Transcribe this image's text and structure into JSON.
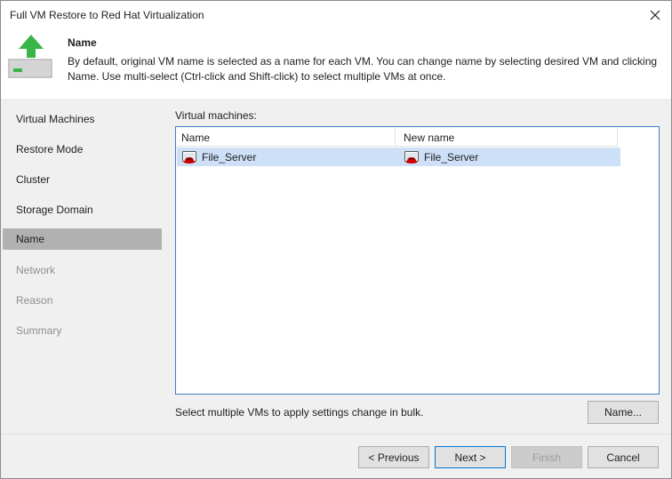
{
  "window": {
    "title": "Full VM Restore to Red Hat Virtualization",
    "close_icon": "close-icon"
  },
  "header": {
    "icon": "restore-upload-icon",
    "title": "Name",
    "description": "By default, original VM name is selected as a name for each VM. You can change name by selecting desired VM and clicking Name. Use multi-select (Ctrl-click and Shift-click) to select multiple VMs at once."
  },
  "sidebar": {
    "steps": [
      {
        "label": "Virtual Machines",
        "state": "normal"
      },
      {
        "label": "Restore Mode",
        "state": "normal"
      },
      {
        "label": "Cluster",
        "state": "normal"
      },
      {
        "label": "Storage Domain",
        "state": "normal"
      },
      {
        "label": "Name",
        "state": "active"
      },
      {
        "label": "Network",
        "state": "disabled"
      },
      {
        "label": "Reason",
        "state": "disabled"
      },
      {
        "label": "Summary",
        "state": "disabled"
      }
    ]
  },
  "main": {
    "vm_label": "Virtual machines:",
    "columns": [
      "Name",
      "New name"
    ],
    "rows": [
      {
        "name": "File_Server",
        "new_name": "File_Server",
        "icon": "redhat-vm-icon",
        "selected": true
      }
    ],
    "hint": "Select multiple VMs to apply settings change in bulk.",
    "name_button": "Name..."
  },
  "footer": {
    "previous": "< Previous",
    "next": "Next >",
    "finish": "Finish",
    "cancel": "Cancel"
  },
  "colors": {
    "accent": "#0078d7",
    "selection": "#cde0f7",
    "sidebar_bg": "#f0f0f0",
    "active_step": "#b1b1b1",
    "icon_green": "#39b54a"
  }
}
